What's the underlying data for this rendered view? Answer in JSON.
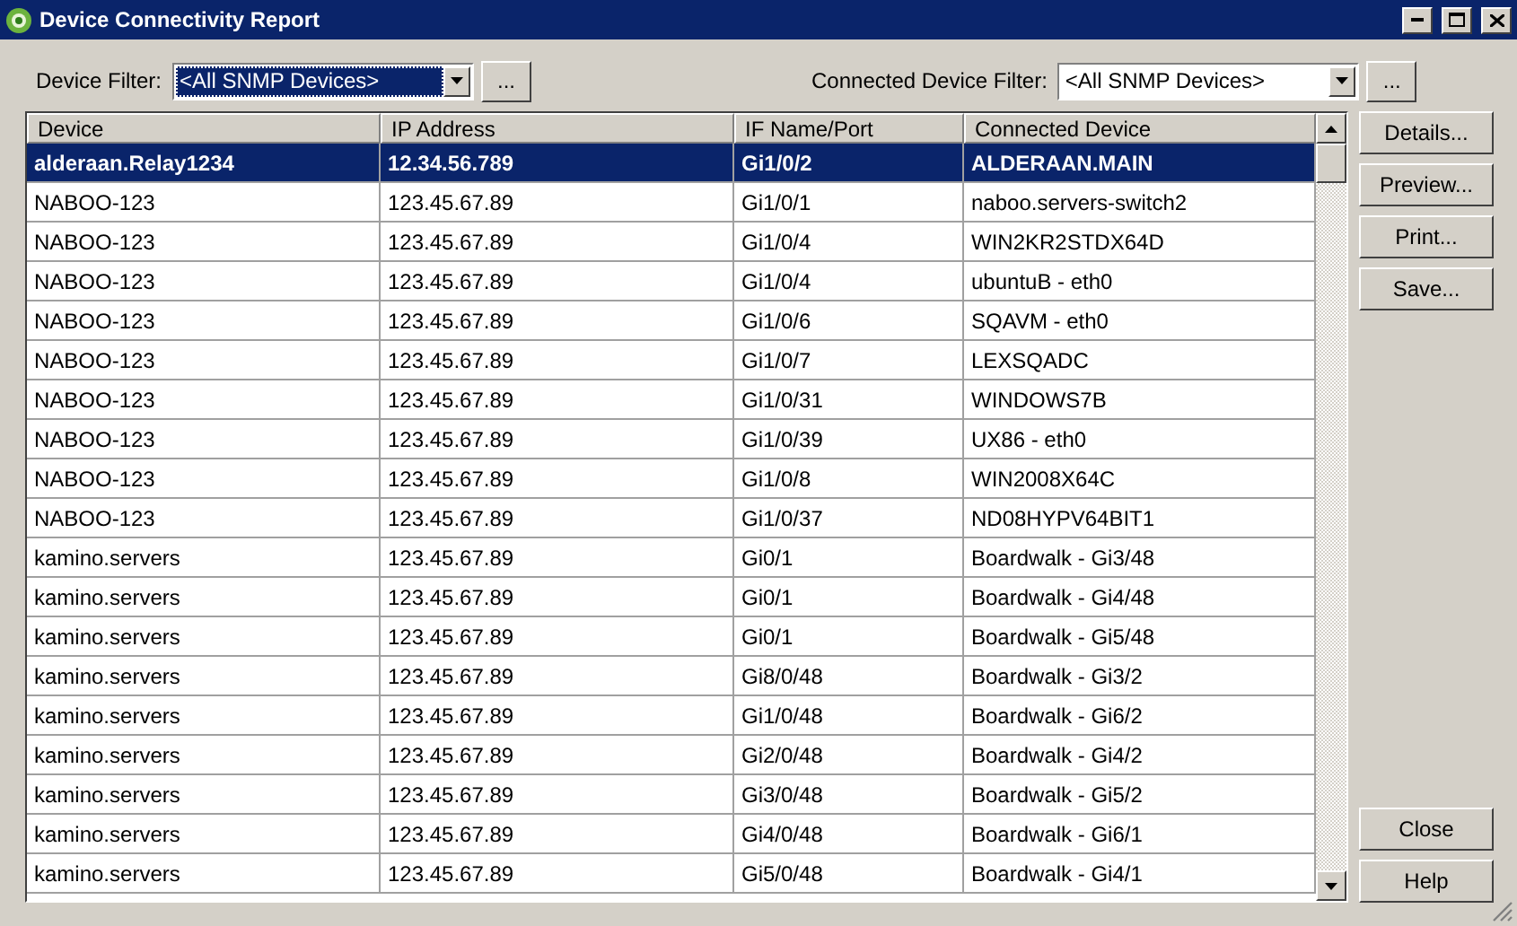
{
  "window": {
    "title": "Device Connectivity Report"
  },
  "filters": [
    {
      "label": "Device Filter:",
      "value": "<All SNMP Devices>",
      "focused": true,
      "button": "..."
    },
    {
      "label": "Connected Device Filter:",
      "value": "<All SNMP Devices>",
      "focused": false,
      "button": "..."
    }
  ],
  "table": {
    "columns": [
      "Device",
      "IP Address",
      "IF Name/Port",
      "Connected Device"
    ],
    "rows": [
      {
        "cells": [
          "alderaan.Relay1234",
          "12.34.56.789",
          "Gi1/0/2",
          "ALDERAAN.MAIN"
        ],
        "selected": true
      },
      {
        "cells": [
          "NABOO-123",
          "123.45.67.89",
          "Gi1/0/1",
          "naboo.servers-switch2"
        ],
        "selected": false
      },
      {
        "cells": [
          "NABOO-123",
          "123.45.67.89",
          "Gi1/0/4",
          "WIN2KR2STDX64D"
        ],
        "selected": false
      },
      {
        "cells": [
          "NABOO-123",
          "123.45.67.89",
          "Gi1/0/4",
          "ubuntuB - eth0"
        ],
        "selected": false
      },
      {
        "cells": [
          "NABOO-123",
          "123.45.67.89",
          "Gi1/0/6",
          "SQAVM - eth0"
        ],
        "selected": false
      },
      {
        "cells": [
          "NABOO-123",
          "123.45.67.89",
          "Gi1/0/7",
          "LEXSQADC"
        ],
        "selected": false
      },
      {
        "cells": [
          "NABOO-123",
          "123.45.67.89",
          "Gi1/0/31",
          "WINDOWS7B"
        ],
        "selected": false
      },
      {
        "cells": [
          "NABOO-123",
          "123.45.67.89",
          "Gi1/0/39",
          "UX86 - eth0"
        ],
        "selected": false
      },
      {
        "cells": [
          "NABOO-123",
          "123.45.67.89",
          "Gi1/0/8",
          "WIN2008X64C"
        ],
        "selected": false
      },
      {
        "cells": [
          "NABOO-123",
          "123.45.67.89",
          "Gi1/0/37",
          "ND08HYPV64BIT1"
        ],
        "selected": false
      },
      {
        "cells": [
          "kamino.servers",
          "123.45.67.89",
          "Gi0/1",
          "Boardwalk - Gi3/48"
        ],
        "selected": false
      },
      {
        "cells": [
          "kamino.servers",
          "123.45.67.89",
          "Gi0/1",
          "Boardwalk - Gi4/48"
        ],
        "selected": false
      },
      {
        "cells": [
          "kamino.servers",
          "123.45.67.89",
          "Gi0/1",
          "Boardwalk - Gi5/48"
        ],
        "selected": false
      },
      {
        "cells": [
          "kamino.servers",
          "123.45.67.89",
          "Gi8/0/48",
          "Boardwalk - Gi3/2"
        ],
        "selected": false
      },
      {
        "cells": [
          "kamino.servers",
          "123.45.67.89",
          "Gi1/0/48",
          "Boardwalk - Gi6/2"
        ],
        "selected": false
      },
      {
        "cells": [
          "kamino.servers",
          "123.45.67.89",
          "Gi2/0/48",
          "Boardwalk - Gi4/2"
        ],
        "selected": false
      },
      {
        "cells": [
          "kamino.servers",
          "123.45.67.89",
          "Gi3/0/48",
          "Boardwalk - Gi5/2"
        ],
        "selected": false
      },
      {
        "cells": [
          "kamino.servers",
          "123.45.67.89",
          "Gi4/0/48",
          "Boardwalk - Gi6/1"
        ],
        "selected": false
      },
      {
        "cells": [
          "kamino.servers",
          "123.45.67.89",
          "Gi5/0/48",
          "Boardwalk - Gi4/1"
        ],
        "selected": false
      }
    ]
  },
  "side_buttons": [
    "Details...",
    "Preview...",
    "Print...",
    "Save..."
  ],
  "bottom_buttons": [
    "Close",
    "Help"
  ]
}
